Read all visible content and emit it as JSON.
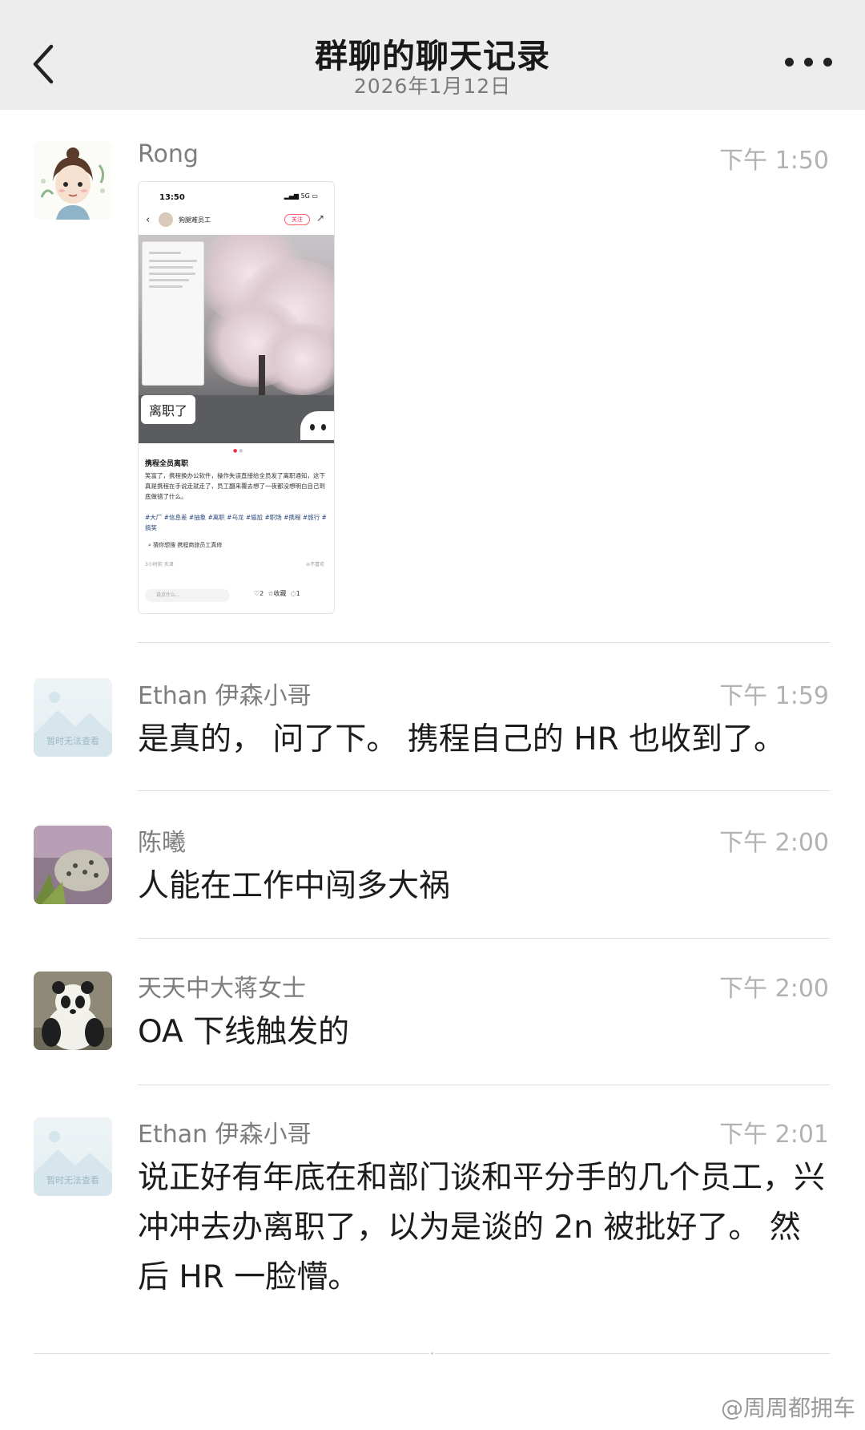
{
  "header": {
    "title": "群聊的聊天记录",
    "date": "2026年1月12日"
  },
  "messages": [
    {
      "sender": "Rong",
      "time": "下午 1:50",
      "type": "image",
      "screenshot": {
        "status_time": "13:50",
        "status_right": "5G",
        "account_name": "狗腿难员工",
        "follow_label": "关注",
        "tag": "离职了",
        "post_title": "携程全员离职",
        "post_body": "笑富了，携程换办公软件，操作失误直接给全员发了离职通知，这下真是携程在手说走就走了，员工翻来覆去想了一夜都没想明白自己到底做错了什么。",
        "post_tags": "#大厂 #信息差 #抽象 #离职 #乌龙 #尴尬 #职场 #携程 #旅行 #搞笑",
        "search_hint": "猜你想搜  携程商旅员工真修",
        "post_meta": "3小时前 天津",
        "not_interested": "不喜欢",
        "input_placeholder": "说点什么...",
        "likes": "2",
        "collect_label": "收藏",
        "comments": "1"
      }
    },
    {
      "sender": "Ethan 伊森小哥",
      "time": "下午 1:59",
      "type": "text",
      "avatar_caption": "暂时无法查看",
      "text": "是真的， 问了下。 携程自己的 HR 也收到了。"
    },
    {
      "sender": "陈曦",
      "time": "下午 2:00",
      "type": "text",
      "text": "人能在工作中闯多大祸"
    },
    {
      "sender": "天天中大蒋女士",
      "time": "下午 2:00",
      "type": "text",
      "text": "OA 下线触发的"
    },
    {
      "sender": "Ethan 伊森小哥",
      "time": "下午 2:01",
      "type": "text",
      "avatar_caption": "暂时无法查看",
      "text": "说正好有年底在和部门谈和平分手的几个员工，兴冲冲去办离职了，以为是谈的 2n 被批好了。 然后 HR 一脸懵。"
    }
  ],
  "watermark": "@周周都拥车",
  "colors": {
    "header_bg": "#ededed",
    "accent": "#ff2442"
  }
}
